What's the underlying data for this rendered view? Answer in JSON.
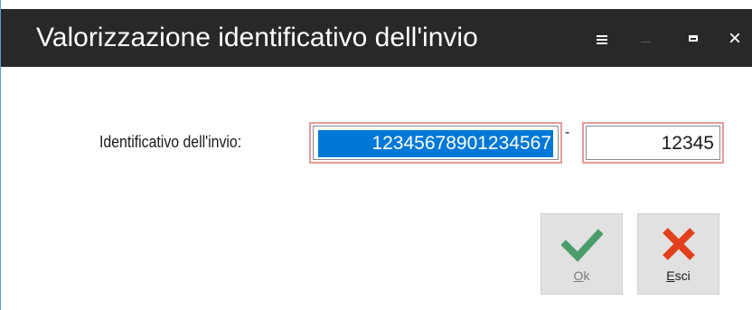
{
  "window": {
    "title": "Valorizzazione identificativo dell'invio"
  },
  "titlebar_icons": [
    "menu-icon",
    "minimize-icon",
    "maximize-icon",
    "close-icon"
  ],
  "form": {
    "label": "Identificativo dell'invio:",
    "main_value": "12345678901234567",
    "separator": "-",
    "secondary_value": "12345"
  },
  "buttons": {
    "ok": {
      "first": "O",
      "rest": "k",
      "icon": "checkmark-icon",
      "color": "#4a9c6d"
    },
    "exit": {
      "first": "E",
      "rest": "sci",
      "icon": "x-icon",
      "color": "#e2401c"
    }
  },
  "colors": {
    "titlebar": "#282828",
    "selection": "#0078d7",
    "field_border": "#e79a9a"
  }
}
